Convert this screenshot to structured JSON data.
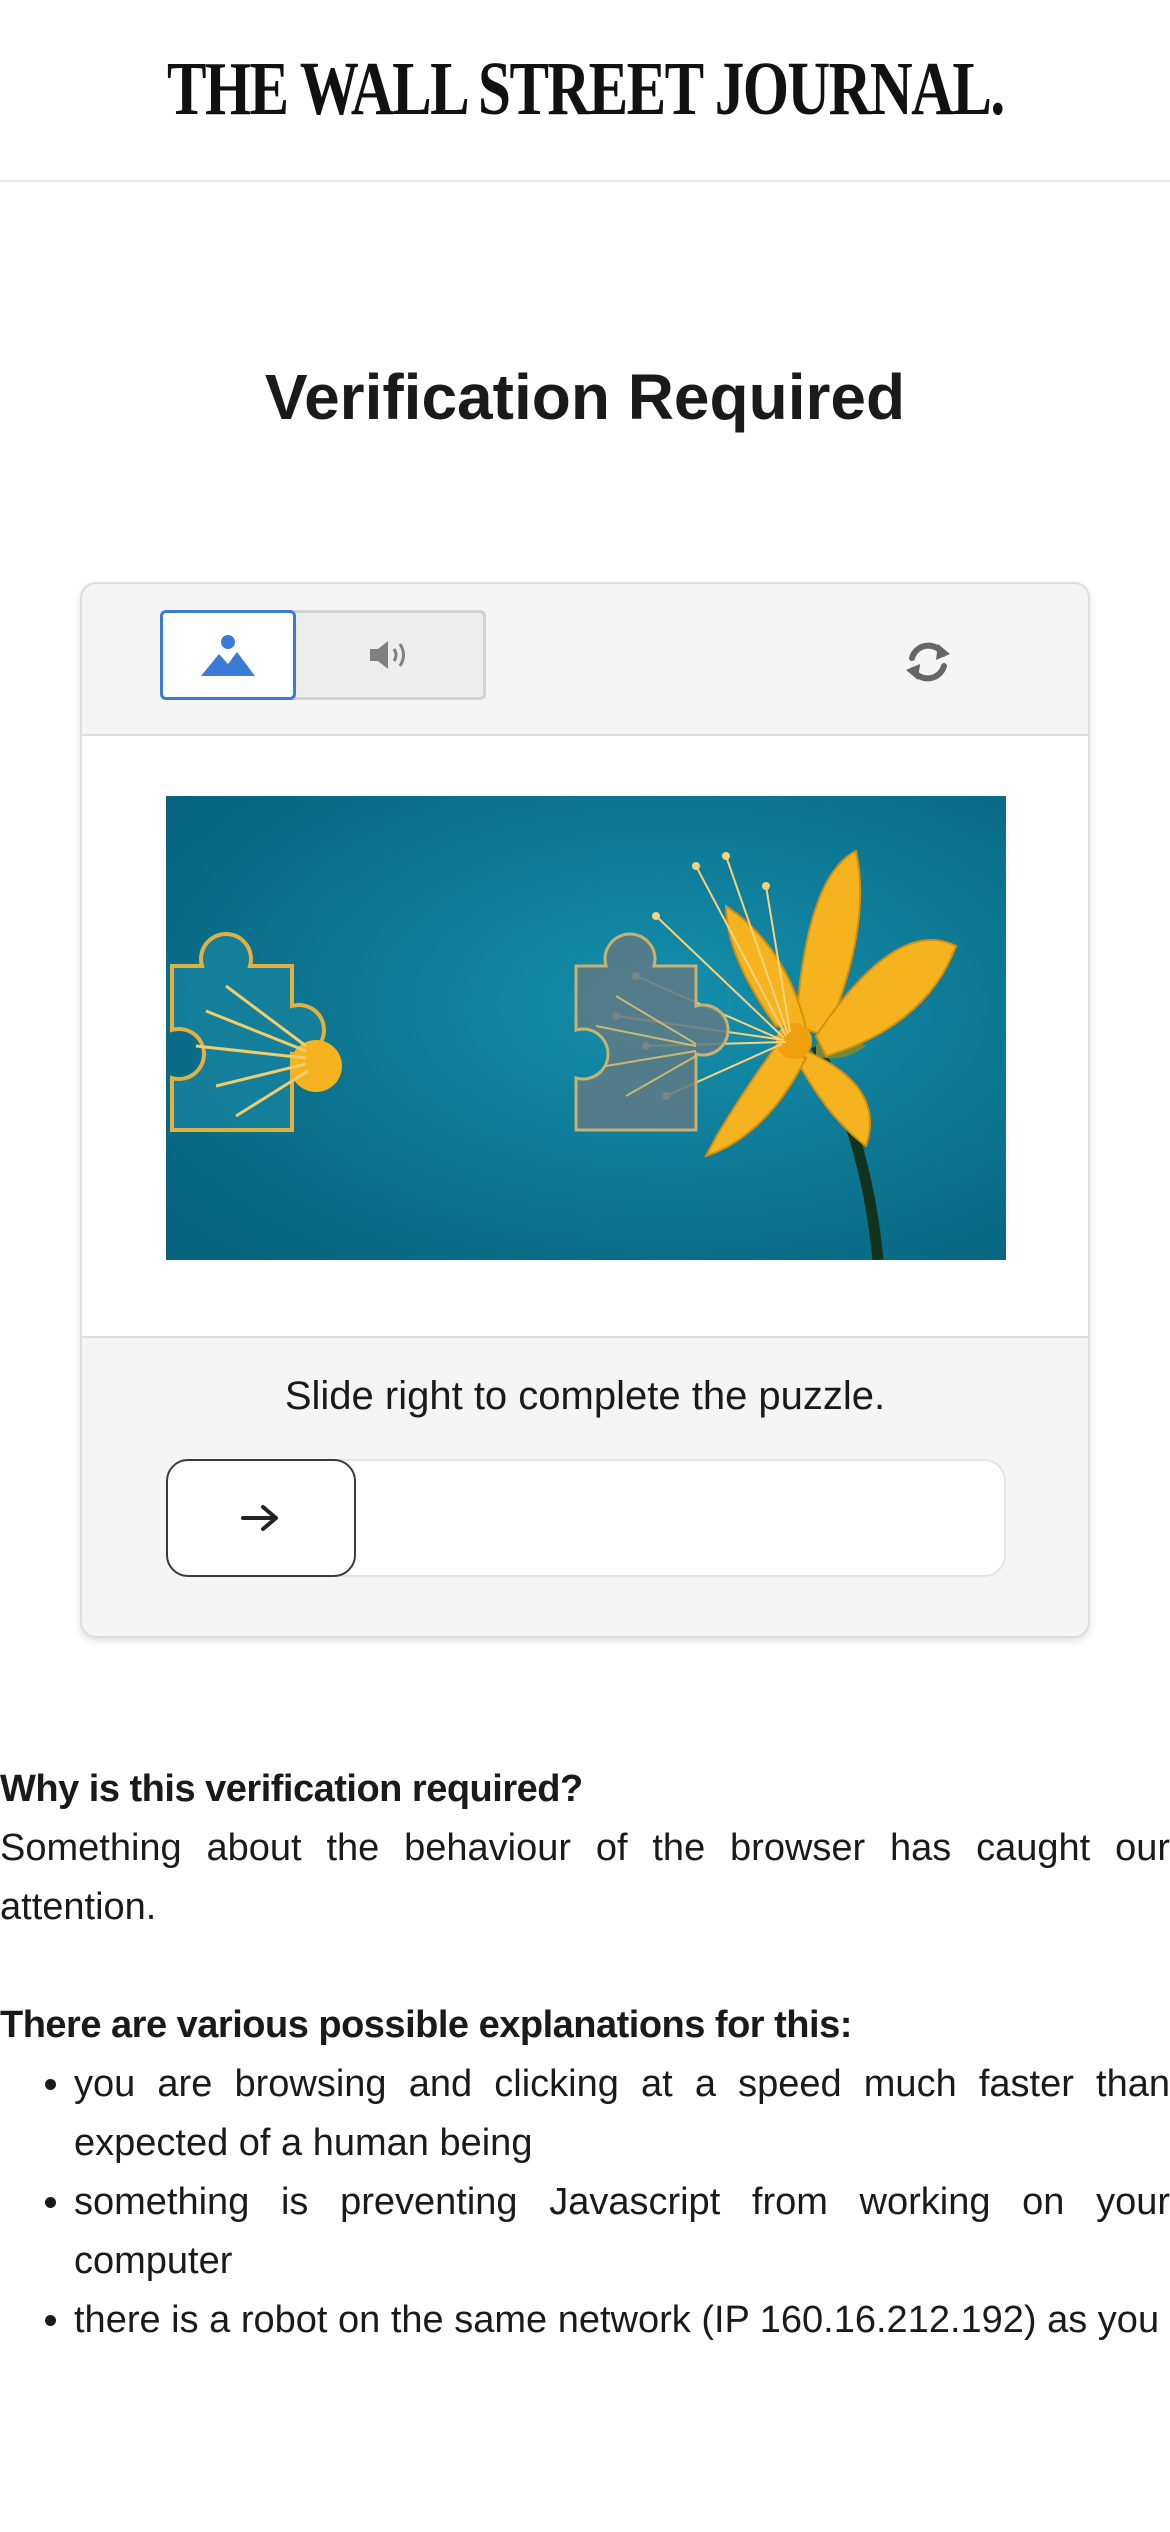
{
  "header": {
    "logo_text": "THE WALL STREET JOURNAL."
  },
  "page": {
    "title": "Verification Required"
  },
  "captcha": {
    "modes": [
      {
        "name": "image",
        "icon": "image-mountain-icon",
        "selected": true
      },
      {
        "name": "audio",
        "icon": "speaker-icon",
        "selected": false
      }
    ],
    "refresh_icon": "refresh-icon",
    "instruction": "Slide right to complete the puzzle.",
    "slider_icon": "arrow-right-icon",
    "slider_progress": 0,
    "colors": {
      "accent": "#3a7bd5",
      "puzzle_background": "#0f7b98",
      "flower": "#f5b31f"
    }
  },
  "info": {
    "why_heading": "Why is this verification required?",
    "why_text": "Something about the behaviour of the browser has caught our attention.",
    "explanations_heading": "There are various possible explanations for this:",
    "explanations": [
      "you are browsing and clicking at a speed much faster than expected of a human being",
      "something is preventing Javascript from working on your computer",
      "there is a robot on the same network (IP 160.16.212.192) as you"
    ]
  }
}
